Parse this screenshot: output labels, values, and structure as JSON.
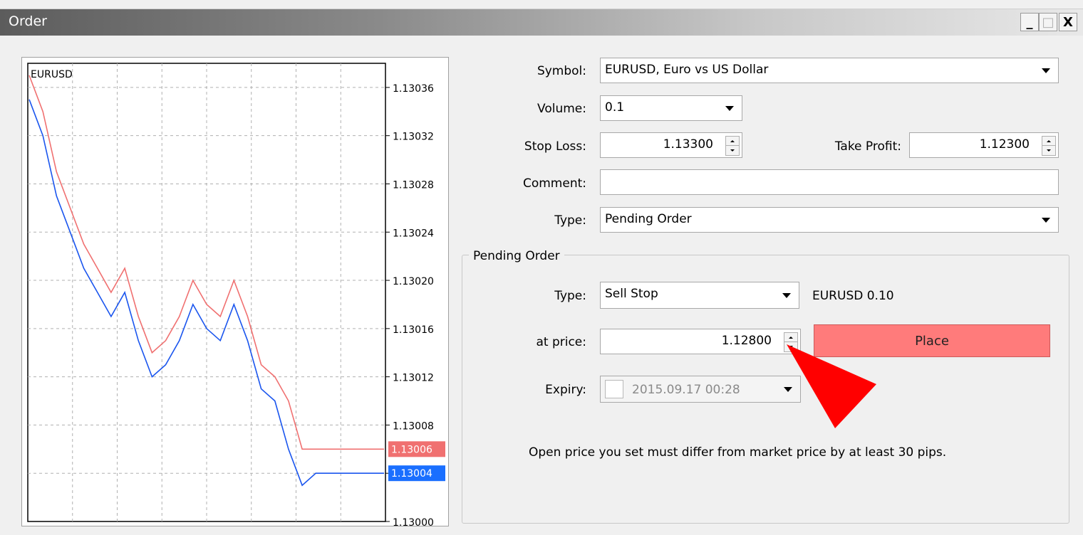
{
  "window": {
    "title": "Order",
    "controls": [
      "_",
      "□",
      "X"
    ]
  },
  "chart": {
    "symbol": "EURUSD",
    "y_ticks": [
      "1.13036",
      "1.13032",
      "1.13028",
      "1.13024",
      "1.13020",
      "1.13016",
      "1.13012",
      "1.13008",
      "1.13004",
      "1.13000"
    ],
    "ask_label": "1.13006",
    "bid_label": "1.13004",
    "colors": {
      "ask": "#f07070",
      "bid": "#1a55ee",
      "grid": "#b0b0b0",
      "ask_label_bg": "#f07070",
      "bid_label_bg": "#1a6fff"
    }
  },
  "chart_data": {
    "type": "line",
    "title": "EURUSD",
    "xlabel": "",
    "ylabel": "",
    "ylim": [
      1.13,
      1.13038
    ],
    "grid": true,
    "series": [
      {
        "name": "",
        "values": [
          1.13037,
          1.13034,
          1.13029,
          1.13026,
          1.13023,
          1.13021,
          1.13019,
          1.13021,
          1.13017,
          1.13014,
          1.13015,
          1.13017,
          1.1302,
          1.13018,
          1.13017,
          1.1302,
          1.13017,
          1.13013,
          1.13012,
          1.1301,
          1.13006,
          1.13006,
          1.13006,
          1.13006,
          1.13006,
          1.13006,
          1.13006
        ]
      },
      {
        "name": "",
        "values": [
          1.13035,
          1.13032,
          1.13027,
          1.13024,
          1.13021,
          1.13019,
          1.13017,
          1.13019,
          1.13015,
          1.13012,
          1.13013,
          1.13015,
          1.13018,
          1.13016,
          1.13015,
          1.13018,
          1.13015,
          1.13011,
          1.1301,
          1.13006,
          1.13003,
          1.13004,
          1.13004,
          1.13004,
          1.13004,
          1.13004,
          1.13004
        ]
      }
    ]
  },
  "form": {
    "symbol_label": "Symbol:",
    "symbol_value": "EURUSD, Euro vs US Dollar",
    "volume_label": "Volume:",
    "volume_value": "0.1",
    "stop_loss_label": "Stop Loss:",
    "stop_loss_value": "1.13300",
    "take_profit_label": "Take Profit:",
    "take_profit_value": "1.12300",
    "comment_label": "Comment:",
    "comment_value": "",
    "type_label": "Type:",
    "type_value": "Pending Order"
  },
  "pending": {
    "group_title": "Pending Order",
    "type_label": "Type:",
    "type_value": "Sell Stop",
    "summary": "EURUSD 0.10",
    "price_label": "at price:",
    "price_value": "1.12800",
    "place_label": "Place",
    "expiry_label": "Expiry:",
    "expiry_value": "2015.09.17 00:28",
    "note": "Open price you set must differ from market price by at least 30 pips."
  }
}
